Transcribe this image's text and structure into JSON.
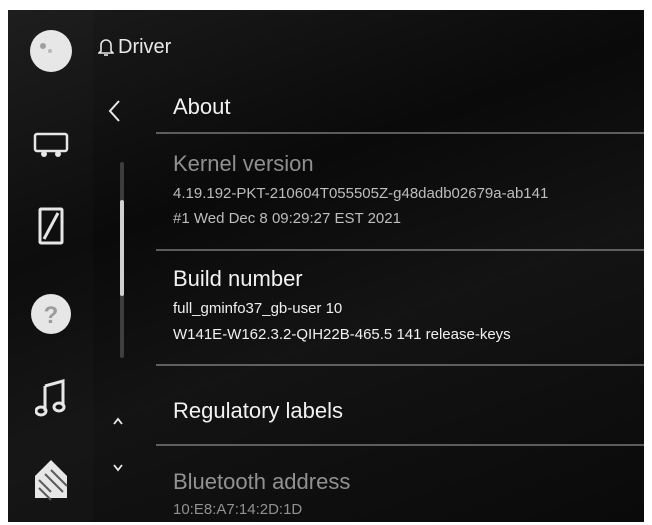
{
  "header": {
    "title": "Driver",
    "icon": "bell-icon"
  },
  "sidebar": {
    "items": [
      {
        "icon": "profile-icon"
      },
      {
        "icon": "car-icon"
      },
      {
        "icon": "phone-icon"
      },
      {
        "icon": "help-icon"
      },
      {
        "icon": "music-note-icon"
      },
      {
        "icon": "home-icon"
      }
    ]
  },
  "page": {
    "title": "About",
    "back_icon": "chevron-left-icon"
  },
  "list": {
    "kernel": {
      "title": "Kernel version",
      "line1": "4.19.192-PKT-210604T055505Z-g48dadb02679a-ab141",
      "line2": "#1 Wed Dec 8 09:29:27 EST 2021"
    },
    "build": {
      "title": "Build number",
      "line1": "full_gminfo37_gb-user 10",
      "line2": "W141E-W162.3.2-QIH22B-465.5 141 release-keys"
    },
    "regulatory": {
      "title": "Regulatory labels"
    },
    "bluetooth": {
      "title": "Bluetooth address",
      "line1": "10:E8:A7:14:2D:1D"
    }
  },
  "scroll": {
    "up_icon": "chevron-up-icon",
    "down_icon": "chevron-down-icon"
  }
}
